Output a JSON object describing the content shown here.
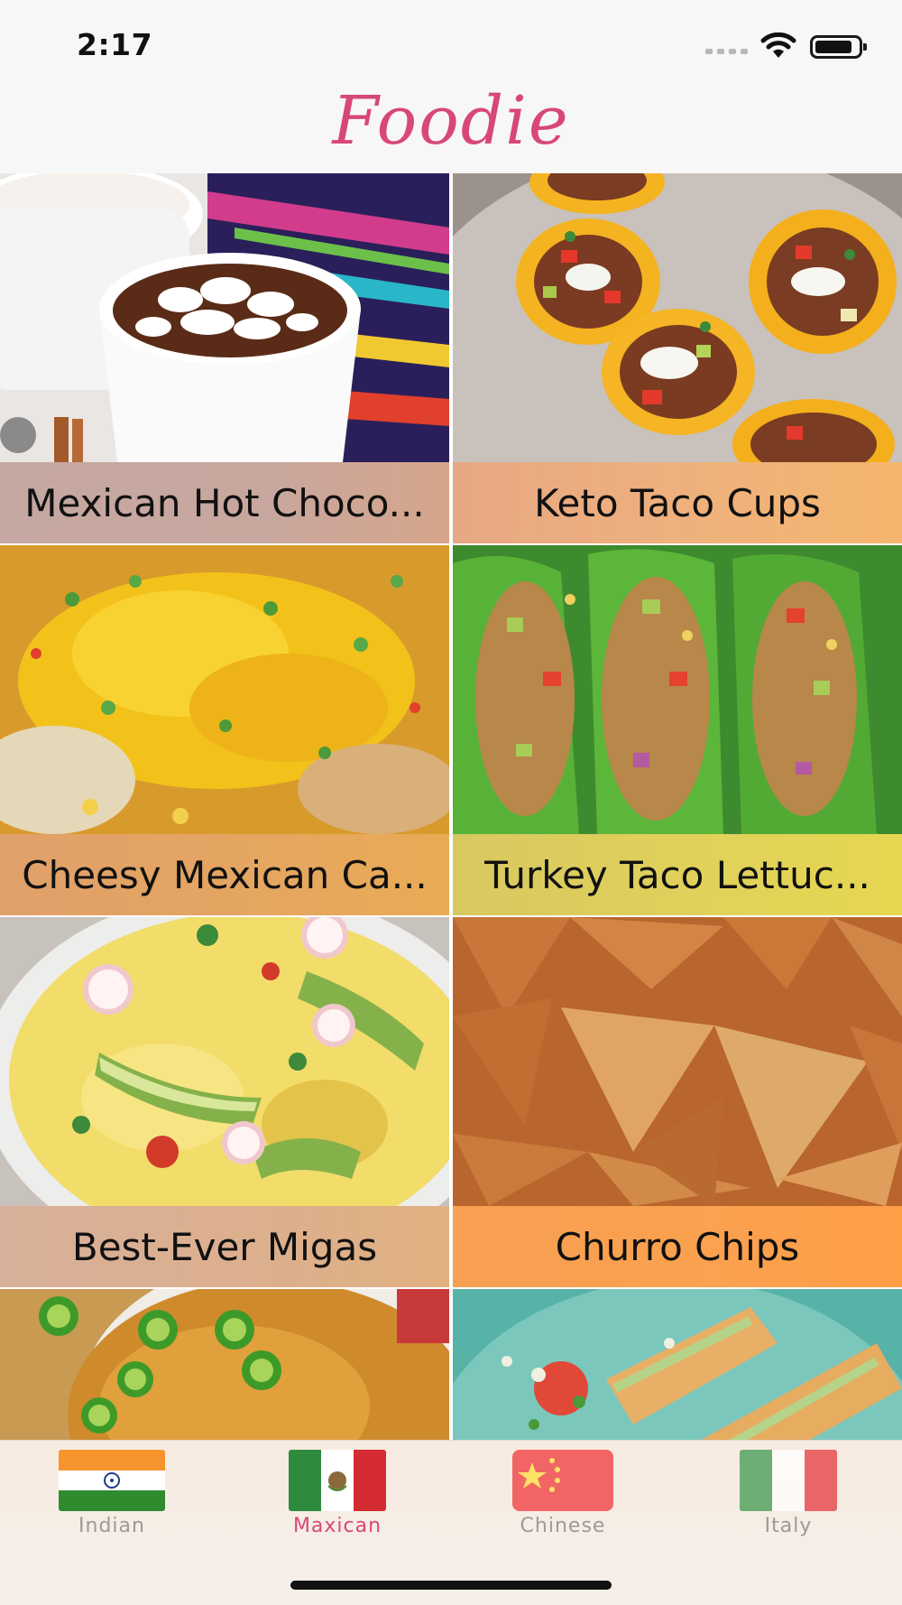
{
  "status_bar": {
    "time": "2:17"
  },
  "header": {
    "title": "Foodie"
  },
  "recipes": [
    {
      "title": "Mexican Hot Choco...",
      "band_color": "#c8a79e"
    },
    {
      "title": "Keto Taco Cups",
      "band_color": "#efb27a"
    },
    {
      "title": "Cheesy Mexican Ca...",
      "band_color": "#e5a660"
    },
    {
      "title": "Turkey Taco Lettuc...",
      "band_color": "#e1d25a"
    },
    {
      "title": "Best-Ever Migas",
      "band_color": "#dcaf8d"
    },
    {
      "title": "Churro Chips",
      "band_color": "#fba14f"
    },
    {
      "title": "",
      "band_color": "#e0a070"
    },
    {
      "title": "",
      "band_color": "#e8b07a"
    }
  ],
  "tabs": [
    {
      "label": "Indian",
      "icon": "india-flag-icon",
      "active": false
    },
    {
      "label": "Maxican",
      "icon": "mexico-flag-icon",
      "active": true
    },
    {
      "label": "Chinese",
      "icon": "china-flag-icon",
      "active": false
    },
    {
      "label": "Italy",
      "icon": "italy-flag-icon",
      "active": false
    }
  ],
  "colors": {
    "accent": "#d8477a",
    "tab_inactive": "#9a9a9a"
  }
}
